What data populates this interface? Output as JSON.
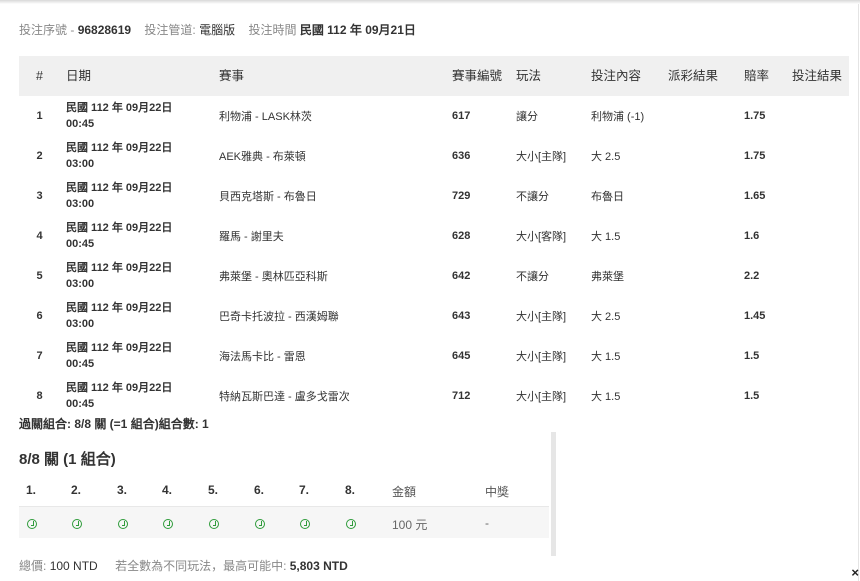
{
  "meta": {
    "serial_label": "投注序號 -",
    "serial_value": "96828619",
    "channel_label": "投注管道:",
    "channel_value": "電腦版",
    "time_label": "投注時間",
    "time_value": "民國 112 年 09月21日"
  },
  "table": {
    "headers": [
      "#",
      "日期",
      "賽事",
      "賽事編號",
      "玩法",
      "投注內容",
      "派彩結果",
      "賠率",
      "投注結果"
    ],
    "rows": [
      {
        "no": "1",
        "date": "民國 112 年 09月22日",
        "time": "00:45",
        "match": "利物浦 - LASK林茨",
        "match_id": "617",
        "play": "讓分",
        "content": "利物浦 (-1)",
        "payout": "",
        "odds": "1.75",
        "result": ""
      },
      {
        "no": "2",
        "date": "民國 112 年 09月22日",
        "time": "03:00",
        "match": "AEK雅典 - 布萊頓",
        "match_id": "636",
        "play": "大小[主隊]",
        "content": "大 2.5",
        "payout": "",
        "odds": "1.75",
        "result": ""
      },
      {
        "no": "3",
        "date": "民國 112 年 09月22日",
        "time": "03:00",
        "match": "貝西克塔斯 - 布魯日",
        "match_id": "729",
        "play": "不讓分",
        "content": "布魯日",
        "payout": "",
        "odds": "1.65",
        "result": ""
      },
      {
        "no": "4",
        "date": "民國 112 年 09月22日",
        "time": "00:45",
        "match": "羅馬 - 謝里夫",
        "match_id": "628",
        "play": "大小[客隊]",
        "content": "大 1.5",
        "payout": "",
        "odds": "1.6",
        "result": ""
      },
      {
        "no": "5",
        "date": "民國 112 年 09月22日",
        "time": "03:00",
        "match": "弗萊堡 - 奧林匹亞科斯",
        "match_id": "642",
        "play": "不讓分",
        "content": "弗萊堡",
        "payout": "",
        "odds": "2.2",
        "result": ""
      },
      {
        "no": "6",
        "date": "民國 112 年 09月22日",
        "time": "03:00",
        "match": "巴奇卡托波拉 - 西漢姆聯",
        "match_id": "643",
        "play": "大小[主隊]",
        "content": "大 2.5",
        "payout": "",
        "odds": "1.45",
        "result": ""
      },
      {
        "no": "7",
        "date": "民國 112 年 09月22日",
        "time": "00:45",
        "match": "海法馬卡比 - 雷恩",
        "match_id": "645",
        "play": "大小[主隊]",
        "content": "大 1.5",
        "payout": "",
        "odds": "1.5",
        "result": ""
      },
      {
        "no": "8",
        "date": "民國 112 年 09月22日",
        "time": "00:45",
        "match": "特納瓦斯巴達 - 盧多戈雷次",
        "match_id": "712",
        "play": "大小[主隊]",
        "content": "大 1.5",
        "payout": "",
        "odds": "1.5",
        "result": ""
      }
    ]
  },
  "summary": "過關組合: 8/8 關 (=1 組合)組合數: 1",
  "parlay": {
    "title": "8/8 關 (1 組合)",
    "legs": [
      "1.",
      "2.",
      "3.",
      "4.",
      "5.",
      "6.",
      "7.",
      "8."
    ],
    "leg_icon": "clock-icon",
    "leg_icon_color": "#2e9b3a",
    "amount_label": "金額",
    "win_label": "中獎",
    "amount_value": "100 元",
    "win_value": "-"
  },
  "footer": {
    "total_label": "總價:",
    "total_value": "100 NTD",
    "max_label": "若全數為不同玩法，最高可能中:",
    "max_value": "5,803 NTD"
  },
  "close": "×"
}
